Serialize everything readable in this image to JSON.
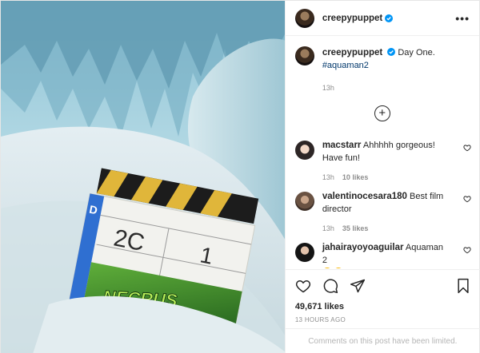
{
  "post": {
    "owner": "creepypuppet",
    "caption_text": "Day One.",
    "caption_hashtag": "#aquaman2",
    "caption_time": "13h",
    "likes": "49,671 likes",
    "posted": "13 HOURS AGO",
    "comments_limited": "Comments on this post have been limited."
  },
  "clapper": {
    "roll": "2C",
    "scene_number": "1",
    "brand": "NECRUS"
  },
  "comments": [
    {
      "user": "macstarr",
      "text": "Ahhhhh gorgeous! Have fun!",
      "time": "13h",
      "likes": "10 likes"
    },
    {
      "user": "valentinocesara180",
      "text": "Best film director",
      "time": "13h",
      "likes": "35 likes"
    },
    {
      "user": "jahairayoyoaguilar",
      "text": "Aquaman 2",
      "emoji_count": 2
    }
  ],
  "icons": {
    "more": "more-options-icon",
    "verified": "verified-badge-icon",
    "load_more": "plus-circle-icon",
    "like": "heart-icon",
    "comment": "comment-icon",
    "share": "paper-plane-icon",
    "save": "bookmark-icon"
  },
  "colors": {
    "verified_blue": "#0095f6",
    "link_blue": "#00376b",
    "muted": "#8e8e8e",
    "emoji_yellow": "#f7b500"
  },
  "glyphs": {
    "more": "•••",
    "plus": "+"
  }
}
